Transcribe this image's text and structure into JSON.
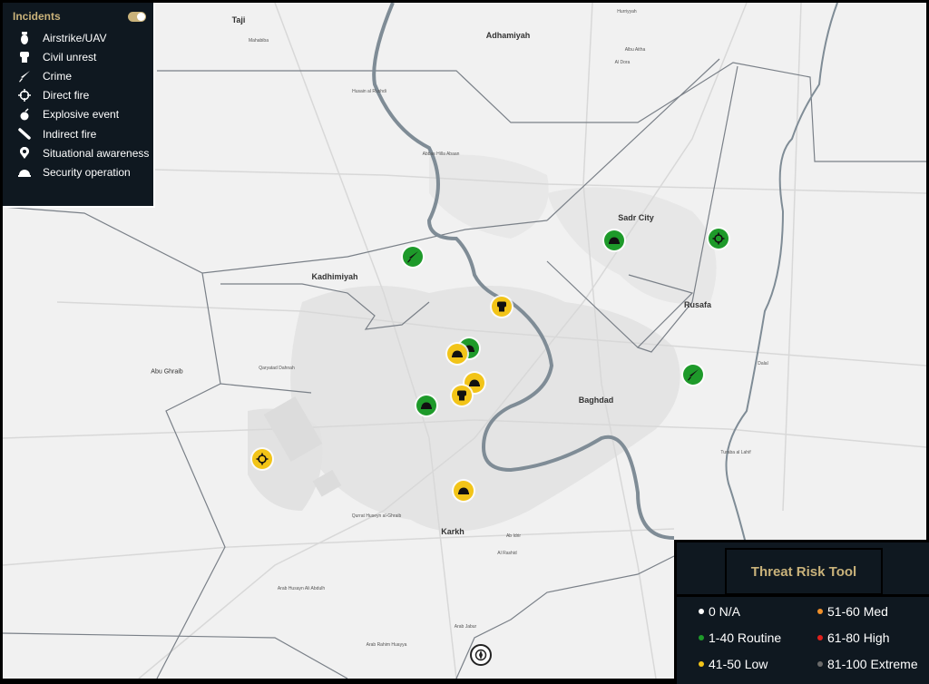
{
  "incidents_panel": {
    "title": "Incidents",
    "toggle_on": true,
    "items": [
      {
        "label": "Airstrike/UAV",
        "icon": "bomb-icon"
      },
      {
        "label": "Civil unrest",
        "icon": "fist-icon"
      },
      {
        "label": "Crime",
        "icon": "knife-icon"
      },
      {
        "label": "Direct fire",
        "icon": "crosshair-icon"
      },
      {
        "label": "Explosive event",
        "icon": "grenade-icon"
      },
      {
        "label": "Indirect fire",
        "icon": "mortar-icon"
      },
      {
        "label": "Situational awareness",
        "icon": "location-pin-icon"
      },
      {
        "label": "Security operation",
        "icon": "helmet-icon"
      }
    ]
  },
  "threat_tool": {
    "title": "Threat Risk Tool",
    "legend": [
      {
        "label": "0 N/A",
        "color": "#ffffff"
      },
      {
        "label": "51-60 Med",
        "color": "#f0902a"
      },
      {
        "label": "1-40 Routine",
        "color": "#1e9a2a"
      },
      {
        "label": "61-80 High",
        "color": "#e0201c"
      },
      {
        "label": "41-50 Low",
        "color": "#f2c418"
      },
      {
        "label": "81-100 Extreme",
        "color": "#6a6a6a"
      }
    ]
  },
  "map_labels": {
    "major": {
      "taji": "Taji",
      "adhamiyah": "Adhamiyah",
      "sadr_city": "Sadr City",
      "kadhimiyah": "Kadhimiyah",
      "rusafa": "Rusafa",
      "baghdad": "Baghdad",
      "abu_ghraib": "Abu Ghraib",
      "karkh": "Karkh"
    },
    "minor": {
      "hussain": "Husain al Rushdi",
      "abbas": "Abbas Hilla Abaan",
      "qaryat": "Qaryatad Dahnah",
      "abi_ghraib_qura": "Qurrat Huseyn al-Ghraib",
      "ard": "Arab Husayn Ali Abdulh",
      "arab_rahim": "Arab Rahim Huayya",
      "arab_jabur": "Arab Jabur",
      "rashid": "Al Rashid",
      "ammen": "Ab Idrir",
      "turaba": "Turaba al Lahif",
      "habibiya": "Hurriyyah",
      "taji_sub": "Mahabiba",
      "dalal": "Dalal",
      "aba": "Albu Aitha",
      "dora": "Al Dora"
    }
  },
  "incidents": [
    {
      "type": "Crime",
      "icon": "knife-icon",
      "risk": "1-40 Routine",
      "color": "#1e9a2a"
    },
    {
      "type": "Security operation",
      "icon": "helmet-icon",
      "risk": "1-40 Routine",
      "color": "#1e9a2a"
    },
    {
      "type": "Direct fire",
      "icon": "crosshair-icon",
      "risk": "1-40 Routine",
      "color": "#1e9a2a"
    },
    {
      "type": "Civil unrest",
      "icon": "fist-icon",
      "risk": "41-50 Low",
      "color": "#f2c418"
    },
    {
      "type": "Security operation",
      "icon": "helmet-icon",
      "risk": "1-40 Routine",
      "color": "#1e9a2a"
    },
    {
      "type": "Security operation",
      "icon": "helmet-icon",
      "risk": "41-50 Low",
      "color": "#f2c418"
    },
    {
      "type": "Security operation",
      "icon": "helmet-icon",
      "risk": "41-50 Low",
      "color": "#f2c418"
    },
    {
      "type": "Civil unrest",
      "icon": "fist-icon",
      "risk": "41-50 Low",
      "color": "#f2c418"
    },
    {
      "type": "Security operation",
      "icon": "helmet-icon",
      "risk": "1-40 Routine",
      "color": "#1e9a2a"
    },
    {
      "type": "Crime",
      "icon": "knife-icon",
      "risk": "1-40 Routine",
      "color": "#1e9a2a"
    },
    {
      "type": "Direct fire",
      "icon": "crosshair-icon",
      "risk": "41-50 Low",
      "color": "#f2c418"
    },
    {
      "type": "Security operation",
      "icon": "helmet-icon",
      "risk": "41-50 Low",
      "color": "#f2c418"
    }
  ]
}
